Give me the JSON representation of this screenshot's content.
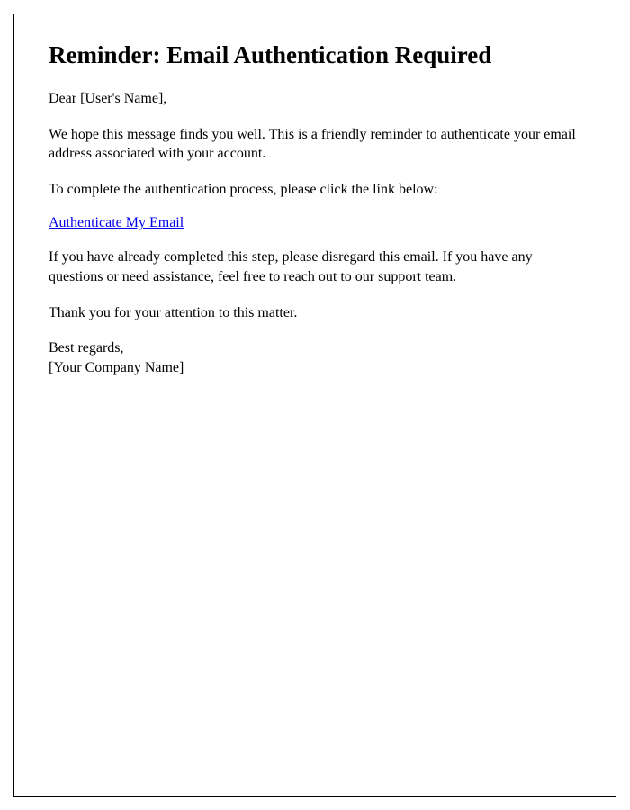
{
  "document": {
    "heading": "Reminder: Email Authentication Required",
    "greeting": "Dear [User's Name],",
    "intro": "We hope this message finds you well. This is a friendly reminder to authenticate your email address associated with your account.",
    "instruction": "To complete the authentication process, please click the link below:",
    "link_text": "Authenticate My Email",
    "disregard": "If you have already completed this step, please disregard this email. If you have any questions or need assistance, feel free to reach out to our support team.",
    "thanks": "Thank you for your attention to this matter.",
    "closing_line1": "Best regards,",
    "closing_line2": "[Your Company Name]"
  }
}
